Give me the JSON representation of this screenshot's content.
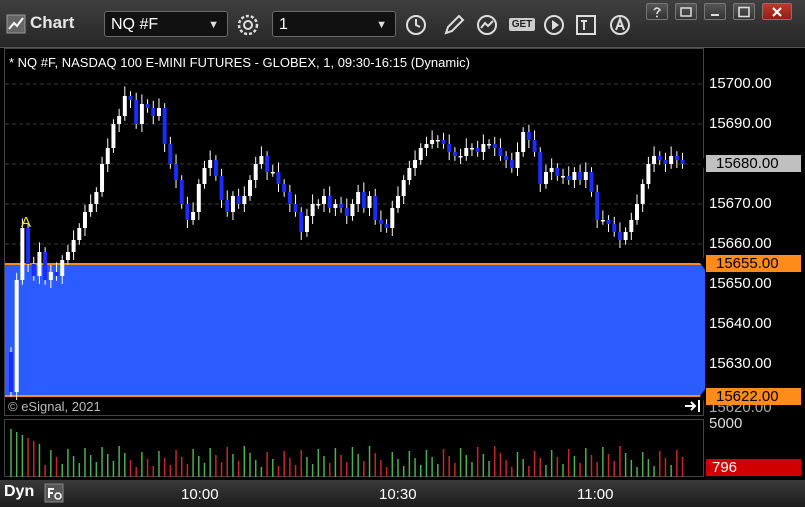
{
  "app": {
    "title": "Chart"
  },
  "toolbar": {
    "symbol_value": "NQ #F",
    "interval_value": "1",
    "get_label": "GET"
  },
  "chart_header": {
    "title": "* NQ #F, NASDAQ 100 E-MINI FUTURES - GLOBEX, 1, 09:30-16:15 (Dynamic)",
    "copyright": "© eSignal, 2021"
  },
  "colors": {
    "up_candle": "#ffffff",
    "down_candle": "#1a2cff",
    "highlight_zone": "#2a5cff",
    "zone_line": "#ff8c1a",
    "current_price_tag": "#c0c0c0",
    "volume_up": "#4caf50",
    "volume_down": "#c62828",
    "volume_tag": "#d00000",
    "marker": "#e8e820"
  },
  "y_axis": {
    "ticks": [
      "15700.00",
      "15690.00",
      "15680.00",
      "15670.00",
      "15660.00",
      "15650.00",
      "15640.00",
      "15630.00",
      "15620.00"
    ]
  },
  "price_tags": {
    "last_price": "15680.00",
    "zone_high": "15655.00",
    "zone_low": "15622.00"
  },
  "volume_axis": {
    "tick": "5000",
    "last_volume": "796"
  },
  "x_axis": {
    "ticks": [
      "10:00",
      "10:30",
      "11:00"
    ]
  },
  "marker_label": "A",
  "bottom_bar": {
    "mode": "Dyn"
  },
  "chart_data": {
    "type": "candlestick",
    "title": "* NQ #F, NASDAQ 100 E-MINI FUTURES - GLOBEX, 1, 09:30-16:15 (Dynamic)",
    "ylim": [
      15617,
      15708
    ],
    "zone": [
      15622,
      15655
    ],
    "last_price": 15680,
    "candles_close": [
      15623,
      15651,
      15664,
      15655,
      15652,
      15658,
      15651,
      15653,
      15652,
      15656,
      15658,
      15661,
      15664,
      15668,
      15670,
      15673,
      15680,
      15684,
      15690,
      15692,
      15697,
      15696,
      15690,
      15695,
      15694,
      15692,
      15694,
      15685,
      15680,
      15676,
      15670,
      15666,
      15668,
      15675,
      15679,
      15681,
      15677,
      15671,
      15668,
      15672,
      15670,
      15672,
      15676,
      15680,
      15682,
      15678,
      15678,
      15675,
      15673,
      15670,
      15668,
      15663,
      15667,
      15670,
      15670,
      15672,
      15669,
      15670,
      15669,
      15667,
      15670,
      15673,
      15669,
      15672,
      15666,
      15665,
      15664,
      15669,
      15672,
      15676,
      15679,
      15681,
      15684,
      15685,
      15686,
      15686,
      15685,
      15683,
      15682,
      15682,
      15684,
      15684,
      15683,
      15685,
      15685,
      15684,
      15682,
      15681,
      15679,
      15683,
      15688,
      15686,
      15683,
      15675,
      15678,
      15679,
      15677,
      15677,
      15676,
      15678,
      15676,
      15678,
      15673,
      15666,
      15666,
      15665,
      15663,
      15661,
      15663,
      15666,
      15670,
      15675,
      15680,
      15682,
      15681,
      15680,
      15682,
      15681,
      15680
    ]
  }
}
